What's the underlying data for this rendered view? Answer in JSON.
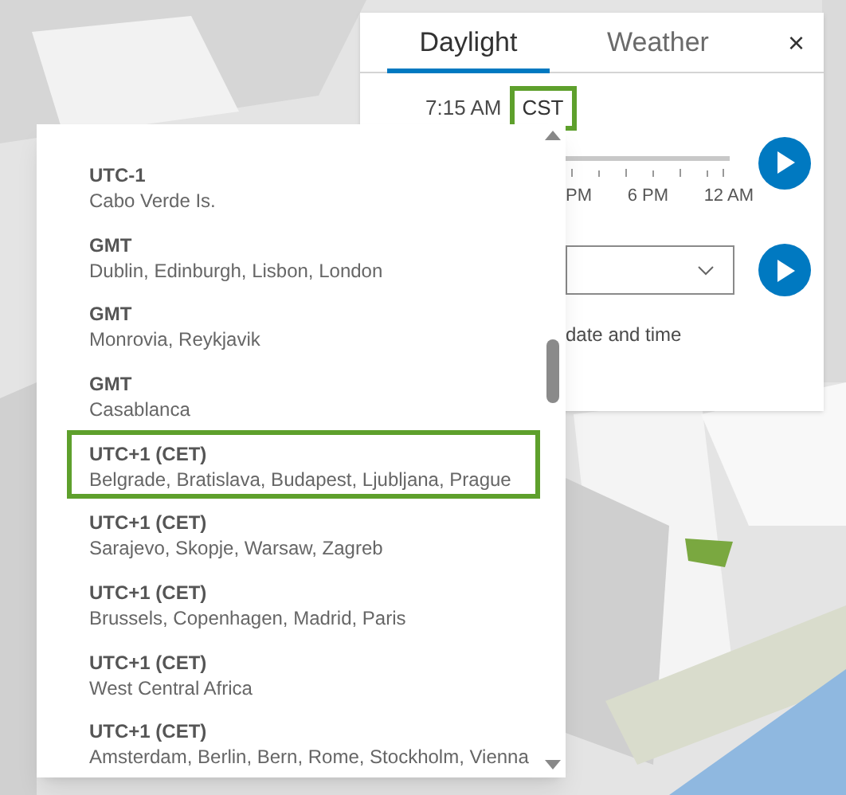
{
  "panel": {
    "tabs": [
      {
        "label": "Daylight",
        "selected": true
      },
      {
        "label": "Weather",
        "selected": false
      }
    ],
    "close": "×",
    "time": "7:15 AM",
    "timezone": {
      "label": "CST",
      "highlighted": true
    },
    "slider": {
      "labels": [
        "PM",
        "6 PM",
        "12 AM"
      ]
    },
    "date_hint": "date and time"
  },
  "timezone_list": {
    "items": [
      {
        "offset": "UTC-1",
        "places": "Cabo Verde Is.",
        "selected": false
      },
      {
        "offset": "GMT",
        "places": "Dublin, Edinburgh, Lisbon, London",
        "selected": false
      },
      {
        "offset": "GMT",
        "places": "Monrovia, Reykjavik",
        "selected": false
      },
      {
        "offset": "GMT",
        "places": "Casablanca",
        "selected": false
      },
      {
        "offset": "UTC+1 (CET)",
        "places": "Belgrade, Bratislava, Budapest, Ljubljana, Prague",
        "selected": true
      },
      {
        "offset": "UTC+1 (CET)",
        "places": "Sarajevo, Skopje, Warsaw, Zagreb",
        "selected": false
      },
      {
        "offset": "UTC+1 (CET)",
        "places": "Brussels, Copenhagen, Madrid, Paris",
        "selected": false
      },
      {
        "offset": "UTC+1 (CET)",
        "places": "West Central Africa",
        "selected": false
      },
      {
        "offset": "UTC+1 (CET)",
        "places": "Amsterdam, Berlin, Bern, Rome, Stockholm, Vienna",
        "selected": false
      }
    ]
  }
}
